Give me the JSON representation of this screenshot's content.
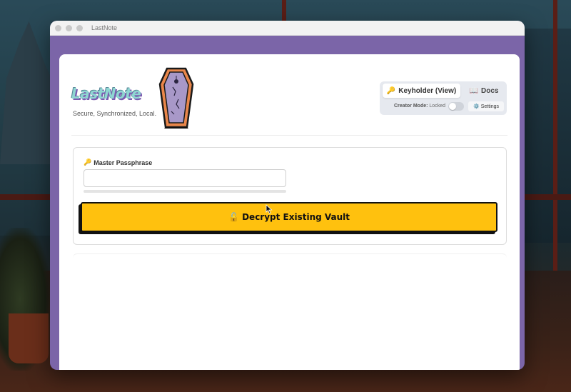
{
  "window": {
    "title": "LastNote"
  },
  "brand": {
    "logo": "LastNote",
    "tagline": "Secure, Synchronized, Local.",
    "coffin_icon": "coffin-icon"
  },
  "mode_tabs": [
    {
      "icon": "🔑",
      "label": "Keyholder (View)",
      "active": true
    },
    {
      "icon": "📖",
      "label": "Docs",
      "active": false
    }
  ],
  "creator_mode": {
    "label": "Creator Mode:",
    "state": "Locked",
    "enabled": false
  },
  "settings": {
    "icon": "⚙️",
    "label": "Settings"
  },
  "form": {
    "passphrase_icon": "🔑",
    "passphrase_label": "Master Passphrase",
    "passphrase_value": "",
    "decrypt_button": "🔓 Decrypt Existing Vault"
  },
  "colors": {
    "window_frame": "#7b65a8",
    "accent_button": "#ffc10e",
    "logo_text": "#8fd6d2"
  }
}
